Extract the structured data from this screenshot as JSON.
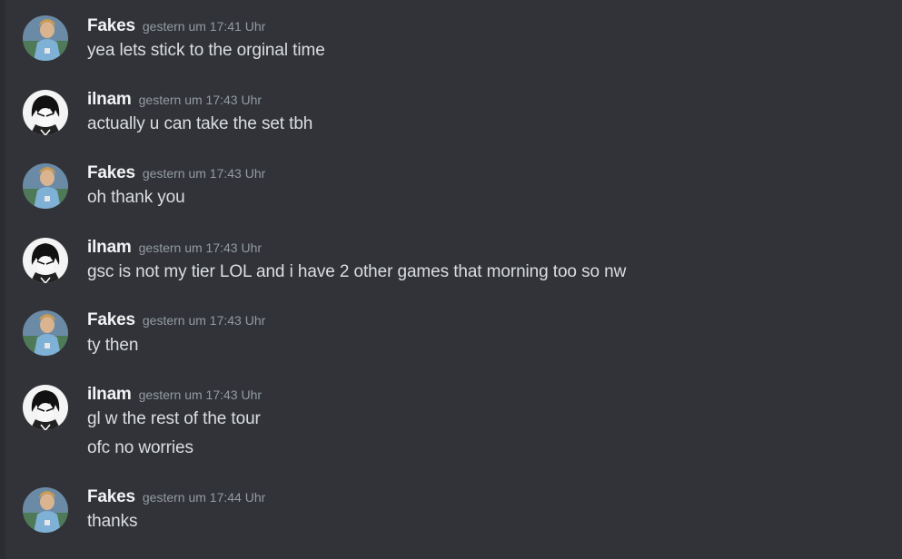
{
  "messages": [
    {
      "author": "Fakes",
      "avatar": "fakes-avatar",
      "timestamp": "gestern um 17:41 Uhr",
      "lines": [
        "yea lets stick to the orginal time"
      ]
    },
    {
      "author": "ilnam",
      "avatar": "ilnam-avatar",
      "timestamp": "gestern um 17:43 Uhr",
      "lines": [
        "actually u can take the set tbh"
      ]
    },
    {
      "author": "Fakes",
      "avatar": "fakes-avatar",
      "timestamp": "gestern um 17:43 Uhr",
      "lines": [
        "oh thank you"
      ]
    },
    {
      "author": "ilnam",
      "avatar": "ilnam-avatar",
      "timestamp": "gestern um 17:43 Uhr",
      "lines": [
        "gsc is not my tier LOL and i have 2 other games that morning too so nw"
      ]
    },
    {
      "author": "Fakes",
      "avatar": "fakes-avatar",
      "timestamp": "gestern um 17:43 Uhr",
      "lines": [
        "ty then"
      ]
    },
    {
      "author": "ilnam",
      "avatar": "ilnam-avatar",
      "timestamp": "gestern um 17:43 Uhr",
      "lines": [
        "gl w the rest of the tour",
        "ofc no worries"
      ]
    },
    {
      "author": "Fakes",
      "avatar": "fakes-avatar",
      "timestamp": "gestern um 17:44 Uhr",
      "lines": [
        "thanks"
      ]
    }
  ],
  "colors": {
    "background": "#313338",
    "author": "#f2f3f5",
    "timestamp": "#949ba4",
    "text": "#dbdee1"
  }
}
